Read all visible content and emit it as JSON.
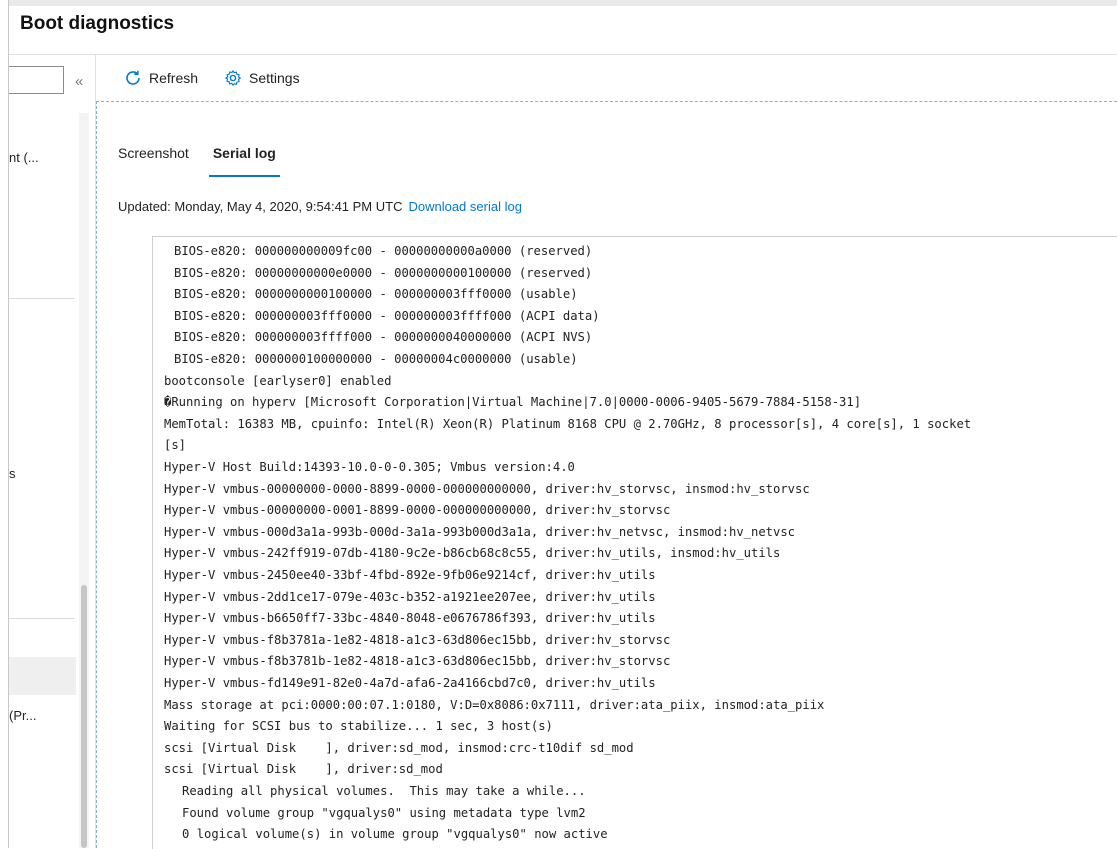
{
  "header": {
    "title": "Boot diagnostics"
  },
  "sidebar": {
    "collapse_glyph": "«",
    "fragments": [
      "nt (...",
      "s",
      "(Pr..."
    ]
  },
  "toolbar": {
    "refresh_label": "Refresh",
    "settings_label": "Settings",
    "refresh_icon": "refresh-icon",
    "settings_icon": "gear-icon"
  },
  "tabs": [
    {
      "label": "Screenshot",
      "active": false
    },
    {
      "label": "Serial log",
      "active": true
    }
  ],
  "status": {
    "updated_text": "Updated: Monday, May 4, 2020, 9:54:41 PM UTC",
    "download_link": "Download serial log"
  },
  "colors": {
    "accent": "#0078d4"
  },
  "log_lines": [
    {
      "text": "BIOS-e820: 000000000009fc00 - 00000000000a0000 (reserved)",
      "indent": 1
    },
    {
      "text": "BIOS-e820: 00000000000e0000 - 0000000000100000 (reserved)",
      "indent": 1
    },
    {
      "text": "BIOS-e820: 0000000000100000 - 000000003fff0000 (usable)",
      "indent": 1
    },
    {
      "text": "BIOS-e820: 000000003fff0000 - 000000003ffff000 (ACPI data)",
      "indent": 1
    },
    {
      "text": "BIOS-e820: 000000003ffff000 - 0000000040000000 (ACPI NVS)",
      "indent": 1
    },
    {
      "text": "BIOS-e820: 0000000100000000 - 00000004c0000000 (usable)",
      "indent": 1
    },
    {
      "text": "bootconsole [earlyser0] enabled",
      "indent": 0
    },
    {
      "text": "�Running on hyperv [Microsoft Corporation|Virtual Machine|7.0|0000-0006-9405-5679-7884-5158-31]",
      "indent": 0
    },
    {
      "text": "MemTotal: 16383 MB, cpuinfo: Intel(R) Xeon(R) Platinum 8168 CPU @ 2.70GHz, 8 processor[s], 4 core[s], 1 socket",
      "indent": 0
    },
    {
      "text": "[s]",
      "indent": 0
    },
    {
      "text": "Hyper-V Host Build:14393-10.0-0-0.305; Vmbus version:4.0",
      "indent": 0
    },
    {
      "text": "Hyper-V vmbus-00000000-0000-8899-0000-000000000000, driver:hv_storvsc, insmod:hv_storvsc",
      "indent": 0
    },
    {
      "text": "Hyper-V vmbus-00000000-0001-8899-0000-000000000000, driver:hv_storvsc",
      "indent": 0
    },
    {
      "text": "Hyper-V vmbus-000d3a1a-993b-000d-3a1a-993b000d3a1a, driver:hv_netvsc, insmod:hv_netvsc",
      "indent": 0
    },
    {
      "text": "Hyper-V vmbus-242ff919-07db-4180-9c2e-b86cb68c8c55, driver:hv_utils, insmod:hv_utils",
      "indent": 0
    },
    {
      "text": "Hyper-V vmbus-2450ee40-33bf-4fbd-892e-9fb06e9214cf, driver:hv_utils",
      "indent": 0
    },
    {
      "text": "Hyper-V vmbus-2dd1ce17-079e-403c-b352-a1921ee207ee, driver:hv_utils",
      "indent": 0
    },
    {
      "text": "Hyper-V vmbus-b6650ff7-33bc-4840-8048-e0676786f393, driver:hv_utils",
      "indent": 0
    },
    {
      "text": "Hyper-V vmbus-f8b3781a-1e82-4818-a1c3-63d806ec15bb, driver:hv_storvsc",
      "indent": 0
    },
    {
      "text": "Hyper-V vmbus-f8b3781b-1e82-4818-a1c3-63d806ec15bb, driver:hv_storvsc",
      "indent": 0
    },
    {
      "text": "Hyper-V vmbus-fd149e91-82e0-4a7d-afa6-2a4166cbd7c0, driver:hv_utils",
      "indent": 0
    },
    {
      "text": "Mass storage at pci:0000:00:07.1:0180, V:D=0x8086:0x7111, driver:ata_piix, insmod:ata_piix",
      "indent": 0
    },
    {
      "text": "Waiting for SCSI bus to stabilize... 1 sec, 3 host(s)",
      "indent": 0
    },
    {
      "text": "scsi [Virtual Disk    ], driver:sd_mod, insmod:crc-t10dif sd_mod",
      "indent": 0
    },
    {
      "text": "scsi [Virtual Disk    ], driver:sd_mod",
      "indent": 0
    },
    {
      "text": "Reading all physical volumes.  This may take a while...",
      "indent": 2
    },
    {
      "text": "Found volume group \"vgqualys0\" using metadata type lvm2",
      "indent": 2
    },
    {
      "text": "0 logical volume(s) in volume group \"vgqualys0\" now active",
      "indent": 2
    }
  ]
}
